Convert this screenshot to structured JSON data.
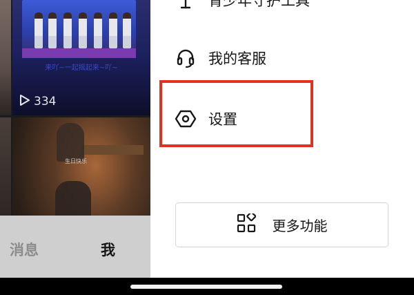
{
  "feed": {
    "stage_caption": "来吖~一起摇起来~吖~",
    "play_count": "334",
    "room_caption": "生日快乐"
  },
  "tabbar": {
    "messages": "消息",
    "me": "我"
  },
  "drawer": {
    "partial_item": "青少年守护工具",
    "service_item": "我的客服",
    "settings_item": "设置",
    "more_features": "更多功能"
  },
  "colors": {
    "highlight": "#e0321f",
    "drawer_bg": "#ffffff",
    "text": "#161616"
  }
}
